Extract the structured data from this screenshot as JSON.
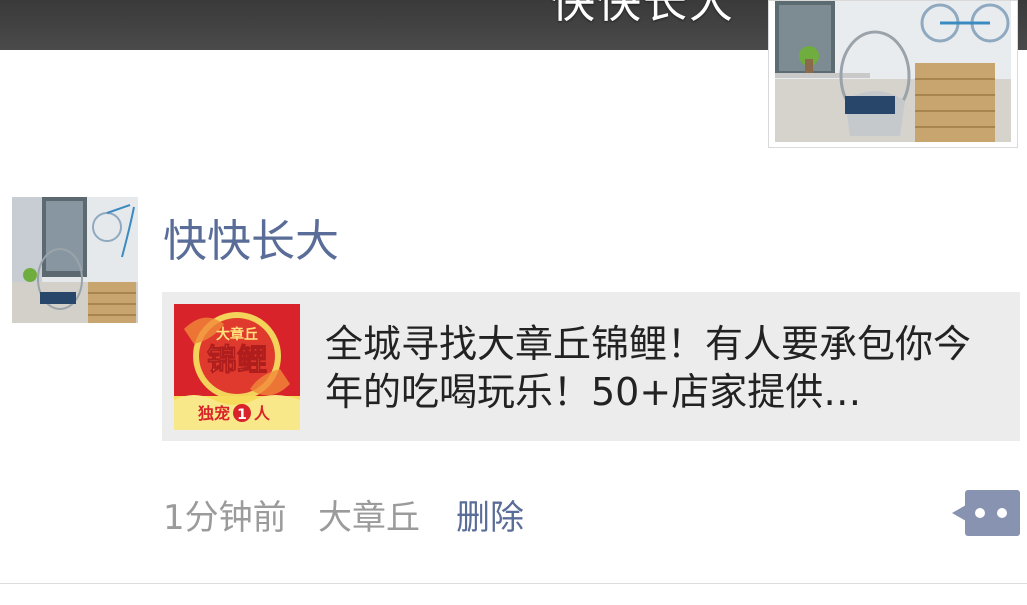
{
  "cover": {
    "name": "快快长大"
  },
  "post": {
    "nickname": "快快长大",
    "share": {
      "title": "全城寻找大章丘锦鲤！有人要承包你今年的吃喝玩乐！50+店家提供…",
      "thumb": {
        "top_text": "大章丘",
        "main_text": "锦鲤",
        "bottom_text": "独宠",
        "bottom_num": "1",
        "bottom_suffix": "人"
      }
    },
    "time": "1分钟前",
    "location": "大章丘",
    "delete_label": "删除"
  },
  "colors": {
    "link": "#5a6d98",
    "meta_gray": "#9b9b9b",
    "card_bg": "#ececec",
    "comment_btn": "#8793b1"
  },
  "icons": {
    "comment": "comment-more-icon"
  }
}
